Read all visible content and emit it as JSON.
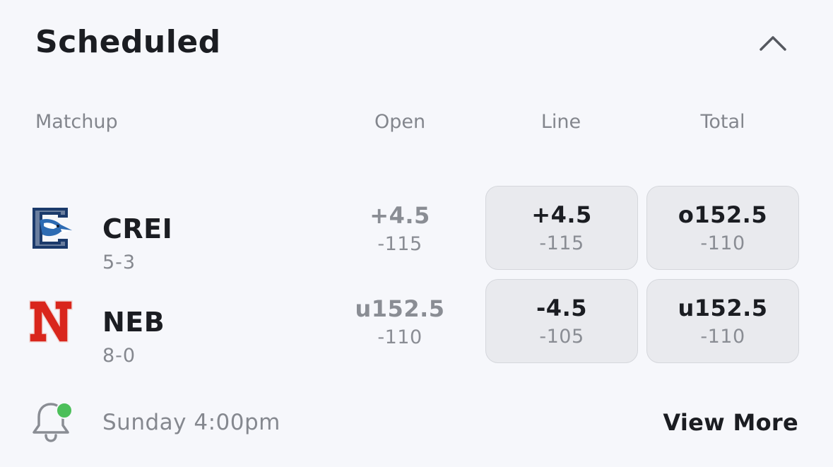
{
  "section": {
    "title": "Scheduled"
  },
  "columns": {
    "matchup": "Matchup",
    "open": "Open",
    "line": "Line",
    "total": "Total"
  },
  "games": [
    {
      "team": "CREI",
      "record": "5-3",
      "open": {
        "main": "+4.5",
        "sub": "-115"
      },
      "line": {
        "main": "+4.5",
        "sub": "-115"
      },
      "total": {
        "main": "o152.5",
        "sub": "-110"
      }
    },
    {
      "team": "NEB",
      "record": "8-0",
      "open": {
        "main": "u152.5",
        "sub": "-110"
      },
      "line": {
        "main": "-4.5",
        "sub": "-105"
      },
      "total": {
        "main": "u152.5",
        "sub": "-110"
      }
    }
  ],
  "footer": {
    "time": "Sunday 4:00pm",
    "view_more": "View More"
  },
  "colors": {
    "background": "#f6f7fb",
    "button_bg": "#e9eaee",
    "alert_dot": "#4cbf5a",
    "neb_red": "#d9261c",
    "crei_blue": "#1b3a6b"
  },
  "icons": {
    "collapse": "chevron-up-icon",
    "alert": "bell-icon"
  }
}
